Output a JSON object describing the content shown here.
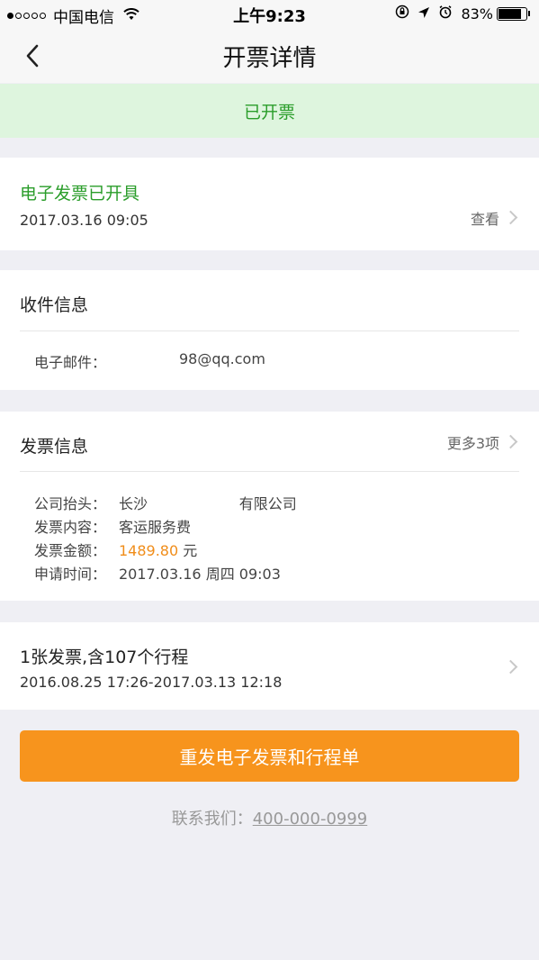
{
  "status_bar": {
    "carrier": "中国电信",
    "time": "上午9:23",
    "battery": "83%",
    "battery_level": 0.83,
    "signal_bars_filled": 1,
    "signal_bars_total": 5
  },
  "nav": {
    "title": "开票详情",
    "back_icon": "chevron-left-icon"
  },
  "banner": {
    "status": "已开票"
  },
  "e_invoice": {
    "title": "电子发票已开具",
    "time": "2017.03.16 09:05",
    "view_label": "查看"
  },
  "recipient": {
    "title": "收件信息",
    "email_label": "电子邮件：",
    "email_value": "98@qq.com"
  },
  "invoice_info": {
    "title": "发票信息",
    "more_label": "更多3项",
    "company_label": "公司抬头：",
    "company_value": "长沙                    有限公司",
    "content_label": "发票内容：",
    "content_value": "客运服务费",
    "amount_label": "发票金额：",
    "amount_value": "1489.80",
    "amount_unit": " 元",
    "apply_label": "申请时间：",
    "apply_value": "2017.03.16 周四 09:03"
  },
  "trips": {
    "title": "1张发票,含107个行程",
    "range": "2016.08.25 17:26-2017.03.13 12:18"
  },
  "actions": {
    "resend_label": "重发电子发票和行程单"
  },
  "contact": {
    "label": "联系我们：",
    "phone": "400-000-0999"
  },
  "colors": {
    "accent_orange": "#f7941d",
    "success_green": "#2a9d2a",
    "banner_bg": "#def5de",
    "amount_orange": "#f08d1a"
  }
}
